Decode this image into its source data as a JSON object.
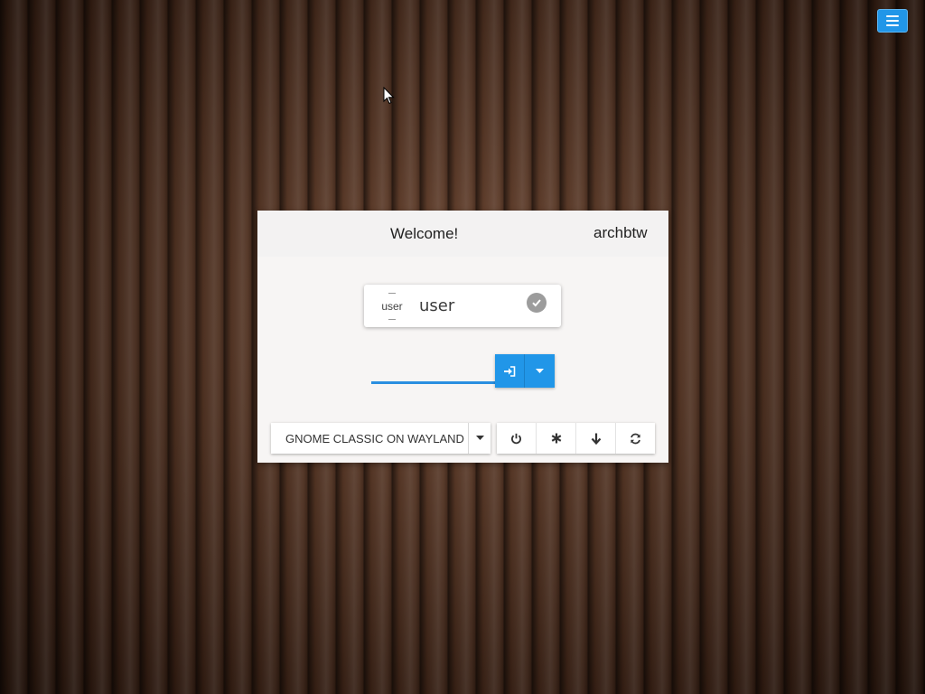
{
  "panel": {
    "title": "Welcome!",
    "hostname": "archbtw"
  },
  "user": {
    "avatar_text": "user",
    "name": "user",
    "selected_icon": "check-icon"
  },
  "password": {
    "value": "",
    "placeholder": ""
  },
  "login": {
    "login_icon": "sign-in-icon",
    "options_icon": "caret-down-icon"
  },
  "session": {
    "selected": "GNOME CLASSIC ON WAYLAND"
  },
  "power_actions": [
    {
      "icon": "power-icon"
    },
    {
      "icon": "asterisk-icon"
    },
    {
      "icon": "arrow-down-icon"
    },
    {
      "icon": "refresh-icon"
    }
  ],
  "colors": {
    "accent": "#2196e8",
    "panel_background": "#f7f5f4"
  }
}
